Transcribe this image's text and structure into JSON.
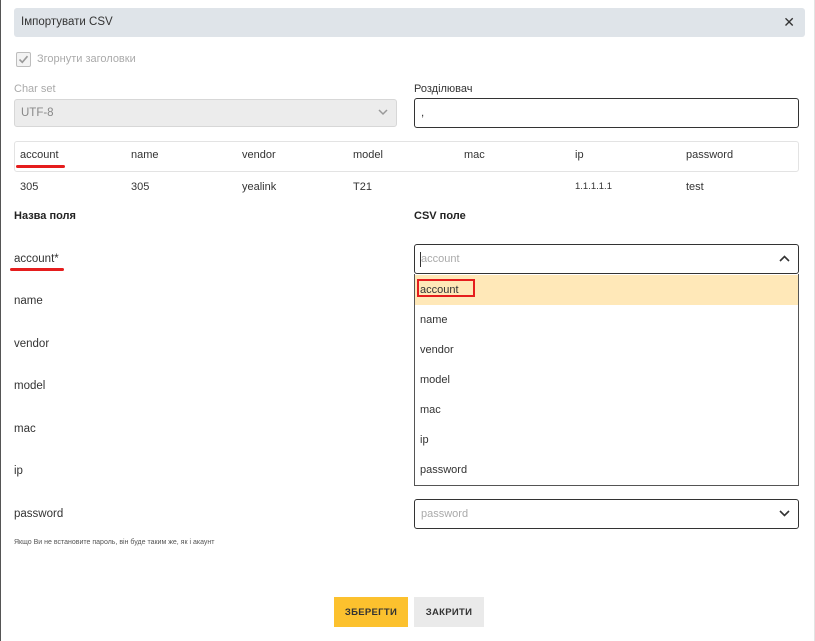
{
  "dialog": {
    "title": "Імпортувати CSV"
  },
  "collapse_headers": {
    "label": "Згорнути заголовки",
    "checked": true
  },
  "charset": {
    "label": "Char set",
    "value": "UTF-8"
  },
  "separator": {
    "label": "Розділювач",
    "value": ","
  },
  "preview": {
    "columns": [
      "account",
      "name",
      "vendor",
      "model",
      "mac",
      "ip",
      "password"
    ],
    "row": [
      "305",
      "305",
      "yealink",
      "T21",
      "",
      "1.1.1.1.1",
      "test"
    ]
  },
  "mapping": {
    "field_header": "Назва поля",
    "csv_header": "CSV поле",
    "fields": [
      "account*",
      "name",
      "vendor",
      "model",
      "mac",
      "ip",
      "password"
    ],
    "account_select": {
      "placeholder": "account"
    },
    "password_select": {
      "placeholder": "password"
    },
    "dropdown_options": [
      "account",
      "name",
      "vendor",
      "model",
      "mac",
      "ip",
      "password"
    ]
  },
  "hint": "Якщо Ви не встановите пароль, він буде таким же, як і акаунт",
  "buttons": {
    "save": "ЗБЕРЕГТИ",
    "close": "ЗАКРИТИ"
  },
  "colors": {
    "header_bg": "#dfe4e9",
    "save_bg": "#fcc12e",
    "highlight_bg": "#ffe8b8",
    "annotation": "#e51d1d"
  }
}
